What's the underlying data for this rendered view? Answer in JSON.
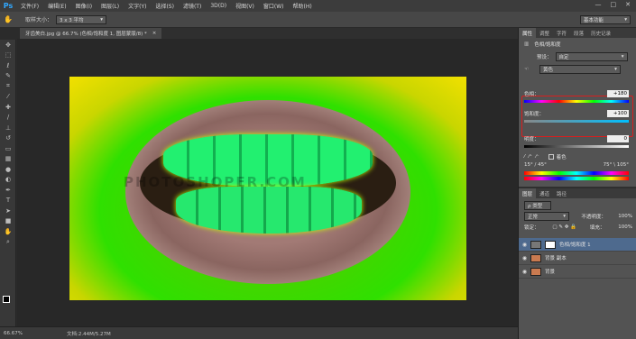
{
  "app": {
    "logo": "Ps"
  },
  "menu": [
    "文件(F)",
    "编辑(E)",
    "图像(I)",
    "图层(L)",
    "文字(Y)",
    "选择(S)",
    "滤镜(T)",
    "3D(D)",
    "视图(V)",
    "窗口(W)",
    "帮助(H)"
  ],
  "window_controls": [
    "—",
    "□",
    "✕"
  ],
  "options": {
    "sample_size_label": "取样大小：",
    "sample_size_value": "3 x 3 平均",
    "workspace": "基本功能"
  },
  "document": {
    "tab_title": "牙齿美白.jpg @ 66.7% (色相/饱和度 1, 图层蒙版/8) *",
    "watermark": "PHOTOSHOPER.COM"
  },
  "status": {
    "zoom": "66.67%",
    "doc_info": "文档:2.44M/5.27M"
  },
  "panels": {
    "top_tabs": [
      "属性",
      "调整",
      "字符",
      "段落",
      "历史记录"
    ],
    "properties": {
      "title": "色相/饱和度",
      "preset_label": "预设：",
      "preset_value": "自定",
      "channel_value": "黄色",
      "hue_label": "色相：",
      "hue_value": "+180",
      "saturation_label": "饱和度：",
      "saturation_value": "+100",
      "lightness_label": "明度：",
      "lightness_value": "0",
      "colorize_label": "着色",
      "range_left": "15° / 45°",
      "range_right": "75° \\ 105°"
    },
    "layer_tabs": [
      "图层",
      "通道",
      "路径"
    ],
    "layers_panel": {
      "kind_label": "ρ 类型",
      "blend_mode": "正常",
      "opacity_label": "不透明度：",
      "opacity_value": "100%",
      "lock_label": "锁定：",
      "fill_label": "填充：",
      "fill_value": "100%",
      "layers": [
        {
          "name": "色相/饱和度 1",
          "selected": true
        },
        {
          "name": "背景 副本",
          "selected": false
        },
        {
          "name": "背景",
          "selected": false
        }
      ]
    }
  },
  "colors": {
    "accent": "#31a8ff",
    "highlight_box": "#d91e1e",
    "selected_layer": "#4e6a8e"
  }
}
